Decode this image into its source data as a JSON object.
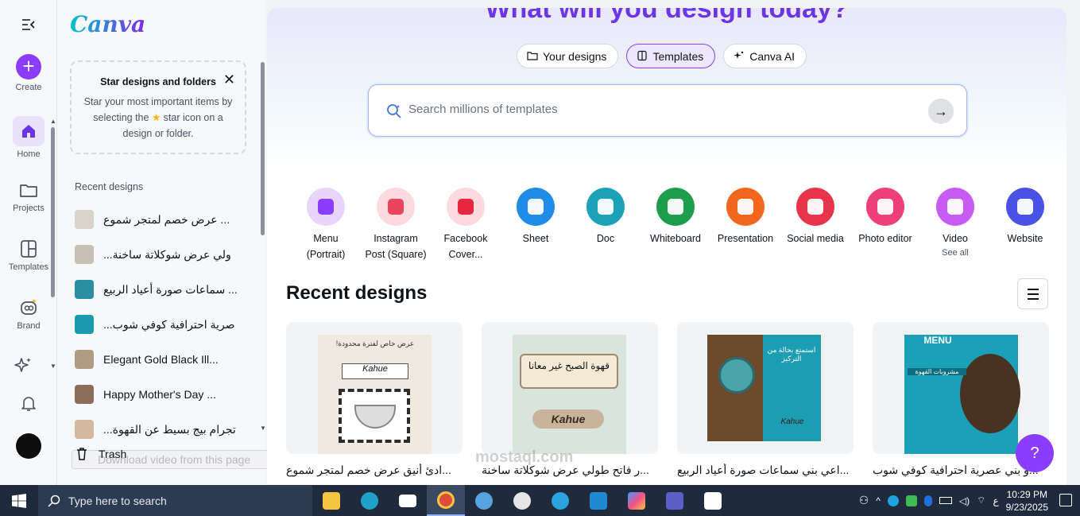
{
  "rail": {
    "create": "Create",
    "home": "Home",
    "projects": "Projects",
    "templates": "Templates",
    "brand": "Brand"
  },
  "panel": {
    "logo": "Canva",
    "star_card": {
      "title": "Star designs and folders",
      "body_1": "Star your most important items by",
      "body_2": "selecting the",
      "body_3": "star icon on a",
      "body_4": "design or folder."
    },
    "recent_label": "Recent designs",
    "recent_items": [
      {
        "label": "عرض خصم لمتجر شموع ...",
        "color": "#d8d3cb"
      },
      {
        "label": "...ولي عرض شوكلاتة ساخنة",
        "color": "#c7c1b5"
      },
      {
        "label": "سماعات صورة أعياد الربيع ...",
        "color": "#2a8fa3"
      },
      {
        "label": "...صرية احترافية كوفي شوب",
        "color": "#1c9bb0"
      },
      {
        "label": "Elegant Gold Black Ill...",
        "color": "#b29b85"
      },
      {
        "label": "Happy Mother's Day ...",
        "color": "#8a6d5a"
      },
      {
        "label": "...تجرام بيج بسيط عن القهوة",
        "color": "#d2b9a0"
      }
    ],
    "trash": "Trash",
    "download_ghost": "Download video from this page"
  },
  "hero": {
    "title": "What will you design today?",
    "pills": [
      {
        "label": "Your designs",
        "active": false
      },
      {
        "label": "Templates",
        "active": true
      },
      {
        "label": "Canva AI",
        "active": false
      }
    ],
    "search_placeholder": "Search millions of templates"
  },
  "categories": [
    {
      "label": "Menu",
      "sub": "(Portrait)",
      "color": "#e9d5fb",
      "inner": "#8b3dff"
    },
    {
      "label": "Instagram",
      "sub": "Post (Square)",
      "color": "#fbd9de",
      "inner": "#e8455d"
    },
    {
      "label": "Facebook",
      "sub": "Cover...",
      "color": "#fbd9de",
      "inner": "#e5263c"
    },
    {
      "label": "Sheet",
      "sub": "",
      "color": "#1f8ce8",
      "inner": "#ffffff"
    },
    {
      "label": "Doc",
      "sub": "",
      "color": "#1ba2b8",
      "inner": "#ffffff"
    },
    {
      "label": "Whiteboard",
      "sub": "",
      "color": "#1e9e4c",
      "inner": "#ffffff"
    },
    {
      "label": "Presentation",
      "sub": "",
      "color": "#f2661e",
      "inner": "#ffffff"
    },
    {
      "label": "Social media",
      "sub": "",
      "color": "#e8354c",
      "inner": "#ffffff"
    },
    {
      "label": "Photo editor",
      "sub": "",
      "color": "#ee3f7b",
      "inner": "#ffffff"
    },
    {
      "label": "Video",
      "sub": "See all",
      "color": "#c85bf3",
      "inner": "#ffffff"
    },
    {
      "label": "Website",
      "sub": "",
      "color": "#4a52e6",
      "inner": "#ffffff"
    }
  ],
  "recent": {
    "title": "Recent designs",
    "cards": [
      {
        "name": "...ادئ أنيق عرض خصم لمتجر شموع",
        "bg": "#efe9df",
        "accent": "#2c2c2c"
      },
      {
        "name": "...ر فاتح طولي عرض شوكلاتة ساخنة",
        "bg": "#d9e4dc",
        "accent": "#9e8a73"
      },
      {
        "name": "...اعي بني سماعات صورة أعياد الربيع",
        "bg": "#1b9db4",
        "accent": "#6e4a2d"
      },
      {
        "name": "...و بني عصرية احترافية كوفي شوب",
        "bg": "#1aa0b8",
        "accent": "#4a3222"
      }
    ],
    "card_images": [
      {
        "text_1": "عرض خاص لفترة محدودة!",
        "text_2": "Kahue"
      },
      {
        "text_1": "قهوة الصبح غير معانا",
        "text_2": "Kahue"
      },
      {
        "text_1": "استمتع بحالة من التركيز",
        "text_2": "Kahue"
      },
      {
        "text_1": "MENU",
        "text_2": "مشروبات القهوة"
      }
    ]
  },
  "help": "?",
  "taskbar": {
    "search": "Type here to search",
    "time": "10:29 PM",
    "date": "9/23/2025",
    "lang": "ع"
  },
  "watermark": "mostaql.com"
}
